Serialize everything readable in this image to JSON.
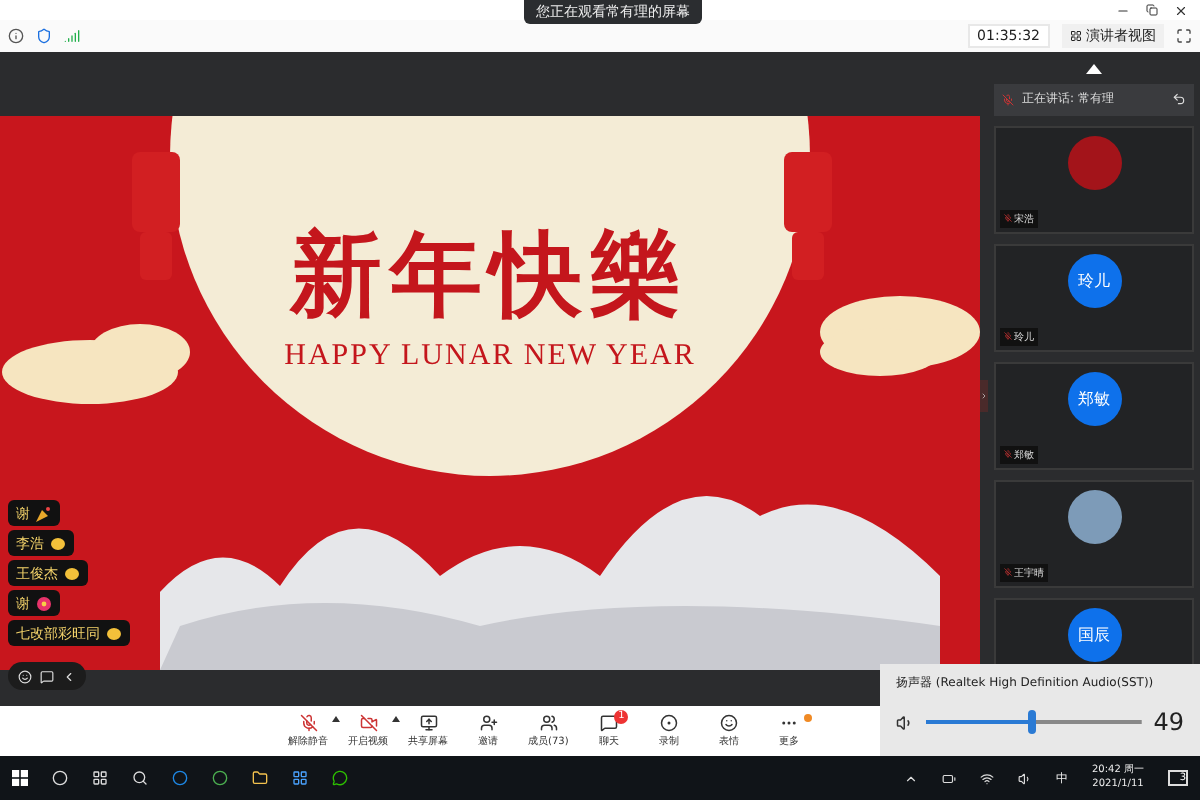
{
  "window": {
    "banner": "您正在观看常有理的屏幕"
  },
  "toolbar": {
    "timer": "01:35:32",
    "view_button": "演讲者视图"
  },
  "slide": {
    "title": "新年快樂",
    "subtitle": "HAPPY LUNAR NEW YEAR"
  },
  "reactions": [
    {
      "name": "谢",
      "kind": "party"
    },
    {
      "name": "李浩",
      "kind": "clap"
    },
    {
      "name": "王俊杰",
      "kind": "clap"
    },
    {
      "name": "谢",
      "kind": "flower"
    },
    {
      "name": "七改部彩旺同",
      "kind": "clap"
    }
  ],
  "speaker_panel": {
    "label": "正在讲话: 常有理",
    "participants": [
      {
        "name": "宋浩",
        "kind": "image"
      },
      {
        "name": "玲儿",
        "kind": "initials",
        "avatar_text": "玲儿"
      },
      {
        "name": "郑敏",
        "kind": "initials",
        "avatar_text": "郑敏"
      },
      {
        "name": "王宇晴",
        "kind": "photo"
      },
      {
        "kind": "initials",
        "avatar_text": "国辰"
      }
    ]
  },
  "meeting_controls": [
    {
      "label": "解除静音",
      "kind": "mic",
      "caret": true
    },
    {
      "label": "开启视频",
      "kind": "video",
      "caret": true
    },
    {
      "label": "共享屏幕",
      "kind": "share",
      "caret": false
    },
    {
      "label": "邀请",
      "kind": "invite",
      "caret": false
    },
    {
      "label": "成员(73)",
      "kind": "members",
      "caret": false
    },
    {
      "label": "聊天",
      "kind": "chat",
      "caret": false,
      "badge": "1"
    },
    {
      "label": "录制",
      "kind": "record",
      "caret": false
    },
    {
      "label": "表情",
      "kind": "emoji",
      "caret": false
    },
    {
      "label": "更多",
      "kind": "more",
      "caret": false,
      "dot": true
    }
  ],
  "volume": {
    "device": "扬声器 (Realtek High Definition Audio(SST))",
    "level": 0.49,
    "reading": "49"
  },
  "taskbar": {
    "ime": "中",
    "time": "20:42 周一",
    "date": "2021/1/11",
    "notifications": "3"
  }
}
